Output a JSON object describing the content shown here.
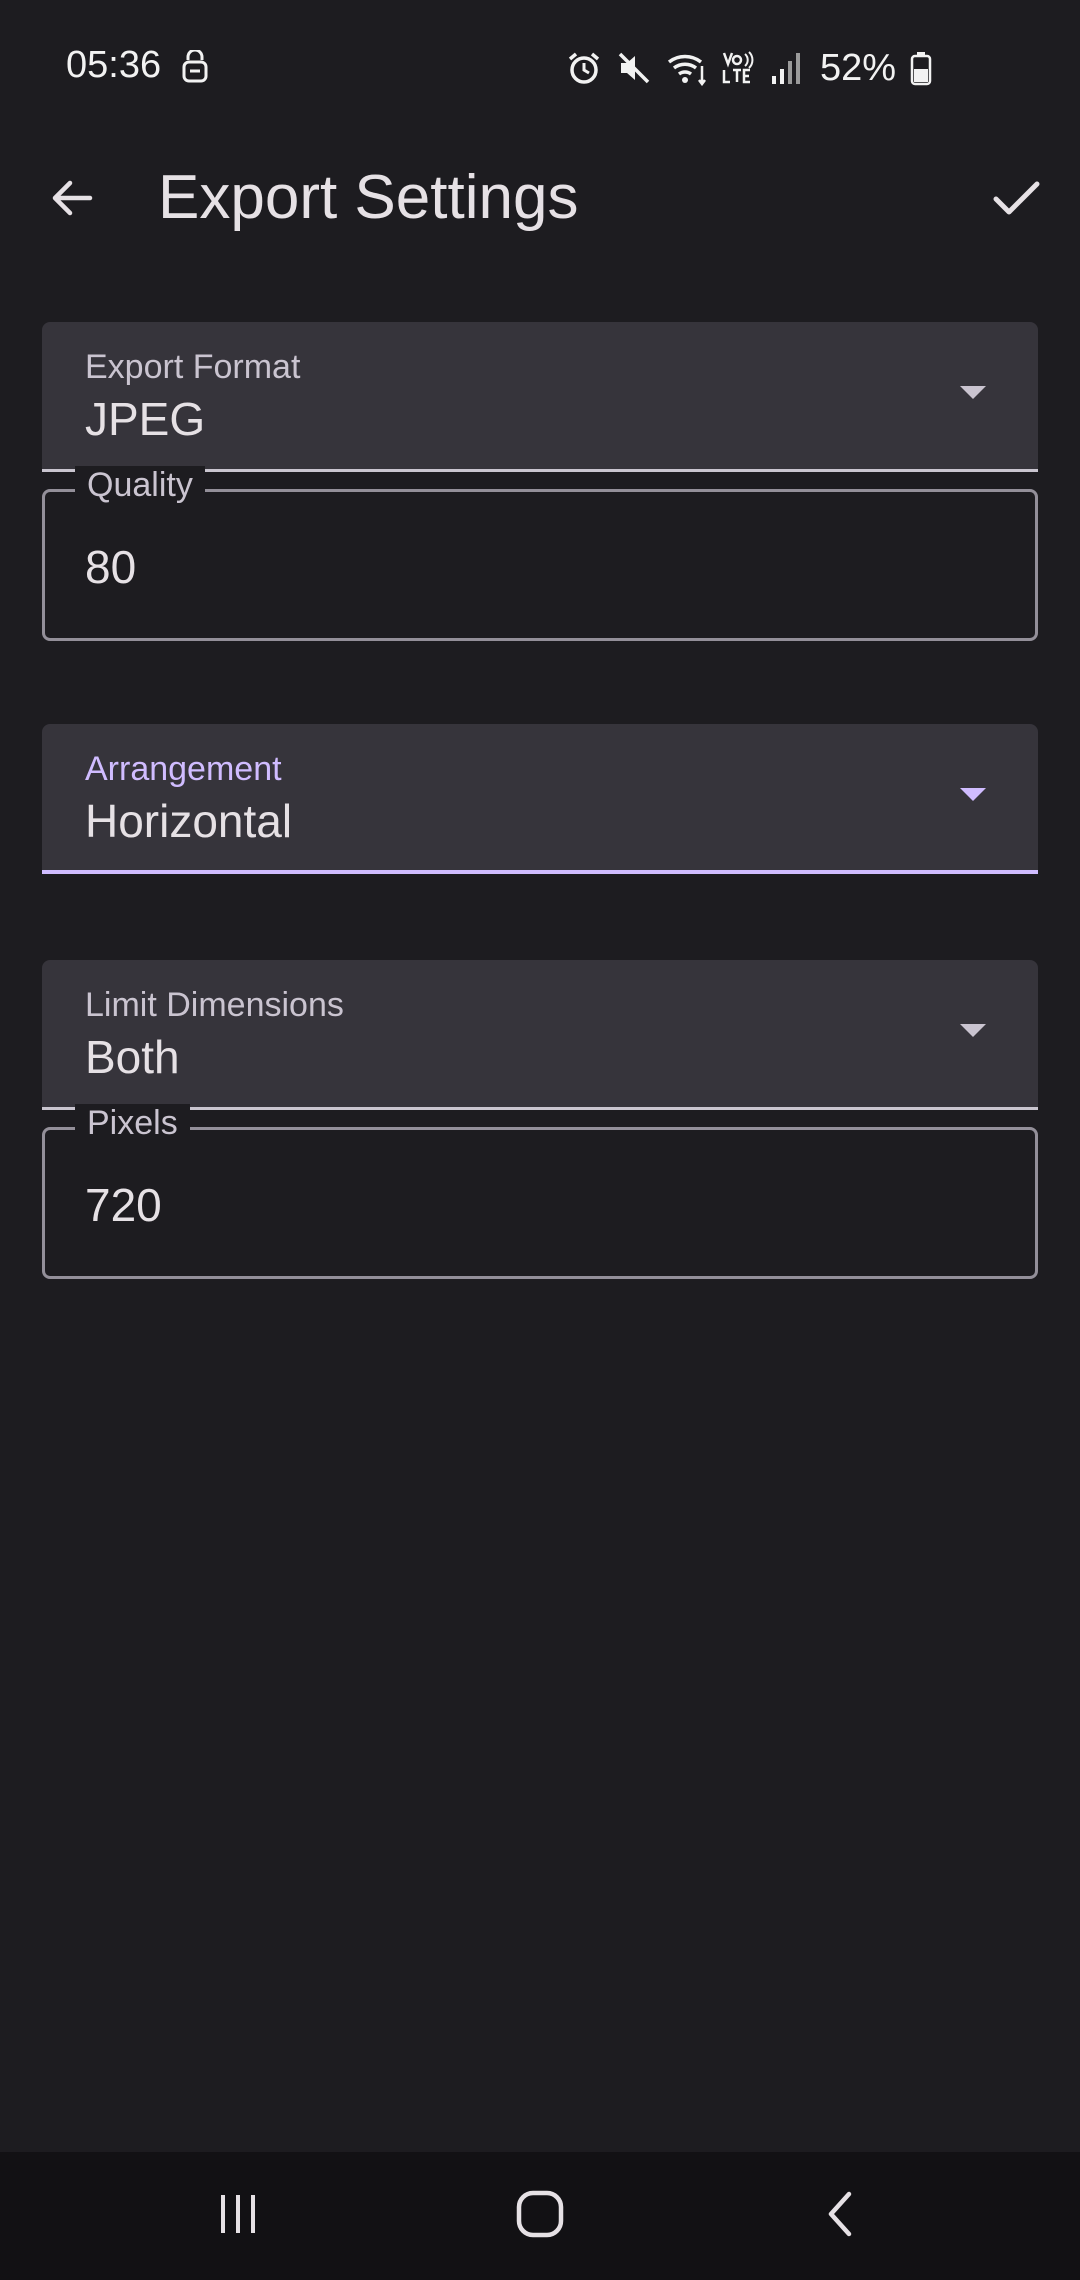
{
  "status_bar": {
    "time": "05:36",
    "battery": "52%"
  },
  "app_bar": {
    "title": "Export Settings",
    "back_icon": "arrow-back-icon",
    "confirm_icon": "check-icon"
  },
  "form": {
    "export_format": {
      "label": "Export Format",
      "value": "JPEG"
    },
    "quality": {
      "label": "Quality",
      "value": "80"
    },
    "arrangement": {
      "label": "Arrangement",
      "value": "Horizontal"
    },
    "limit_dimensions": {
      "label": "Limit Dimensions",
      "value": "Both"
    },
    "pixels": {
      "label": "Pixels",
      "value": "720"
    }
  },
  "colors": {
    "background": "#1d1c20",
    "surface": "#36343b",
    "accent": "#d0bcff",
    "on_surface": "#e6e1e5",
    "on_surface_variant": "#cac4d0",
    "outline": "#938f99"
  }
}
